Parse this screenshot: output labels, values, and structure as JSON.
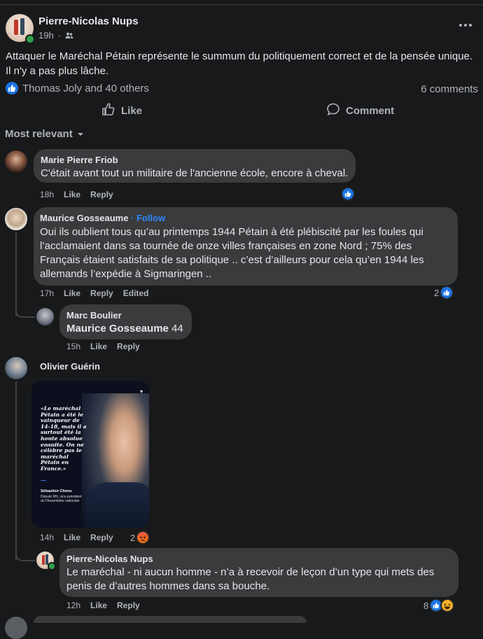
{
  "post": {
    "author": "Pierre-Nicolas Nups",
    "time": "19h",
    "text_line1": "Attaquer le Maréchal Pétain représente le summum du politiquement correct et de la pensée unique.",
    "text_line2": "Il n'y a pas plus lâche.",
    "reactions_text": "Thomas Joly and 40 others",
    "comments_count": "6 comments",
    "like_label": "Like",
    "comment_label": "Comment",
    "sort_label": "Most relevant"
  },
  "comments": {
    "c1": {
      "author": "Marie Pierre Friob",
      "text": "C'était avant tout un militaire de l'ancienne école, encore à cheval.",
      "time": "18h",
      "like": "Like",
      "reply": "Reply"
    },
    "c2": {
      "author": "Maurice Gosseaume",
      "follow": "· Follow",
      "text": "Oui ils oublient tous qu’au printemps 1944 Pétain à été plébiscité par les foules qui l’acclamaient dans sa tournée de onze villes françaises en zone Nord ; 75% des Français étaient satisfaits de sa politique .. c’est d’ailleurs pour cela qu’en 1944 les allemands l’expédie à Sigmaringen ..",
      "time": "17h",
      "like": "Like",
      "reply": "Reply",
      "edited": "Edited",
      "reaction_count": "2"
    },
    "c2r1": {
      "author": "Marc Boulier",
      "mention": "Maurice Gosseaume",
      "text": " 44",
      "time": "15h",
      "like": "Like",
      "reply": "Reply"
    },
    "c3": {
      "author": "Olivier Guérin",
      "time": "14h",
      "like": "Like",
      "reply": "Reply",
      "reaction_count": "2",
      "image": {
        "quote": "«Le maréchal Pétain a été le vainqueur de 14-18, mais il a surtout été la honte absolue ensuite. On ne célèbre pas le maréchal Pétain en France.»",
        "person": "Sébastien Chenu",
        "role": "Député RN, vice-président de l'Assemblée nationale"
      }
    },
    "c3r1": {
      "author": "Pierre-Nicolas Nups",
      "text": "Le maréchal - ni aucun homme - n’a à recevoir de leçon d’un type qui mets des penis de d’autres hommes dans sa bouche.",
      "time": "12h",
      "like": "Like",
      "reply": "Reply",
      "reaction_count": "8"
    }
  },
  "colors": {
    "background": "#18191a",
    "bubble": "#3a3b3c",
    "text": "#e4e6eb",
    "muted": "#b0b3b8",
    "accent": "#1b74e4",
    "follow": "#2d88ff",
    "online": "#31a24c"
  },
  "icons": [
    "more-options-icon",
    "friends-audience-icon",
    "like-reaction-icon",
    "thumb-up-icon",
    "comment-bubble-icon",
    "dropdown-caret-icon",
    "angry-reaction-icon",
    "haha-reaction-icon"
  ]
}
